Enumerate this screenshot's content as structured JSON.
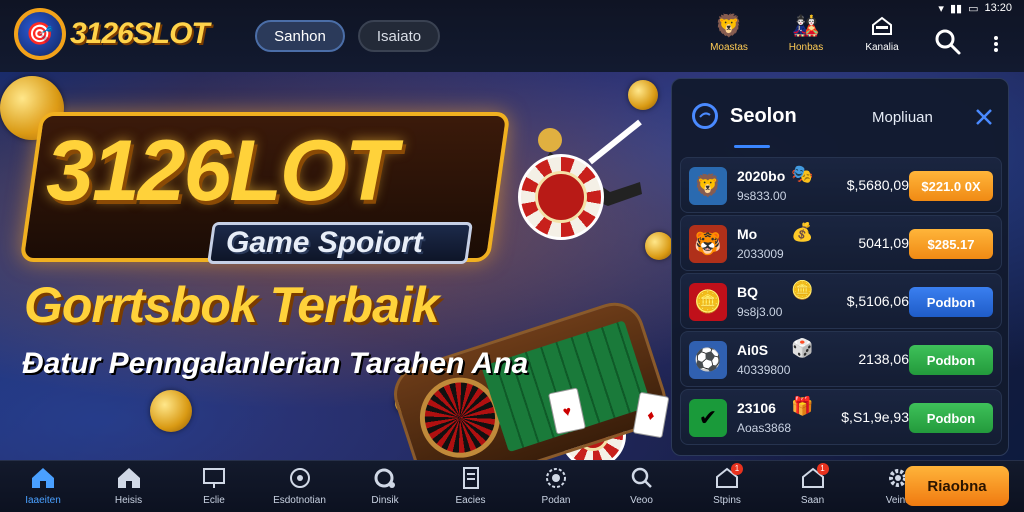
{
  "statusbar": {
    "time": "13:20",
    "icons": [
      "wifi-icon",
      "signal-icon",
      "battery-icon"
    ]
  },
  "header": {
    "logo_text": "3126SLOT",
    "logo_badge": "🎯",
    "pill_primary": "Sanhon",
    "pill_secondary": "Isaiato",
    "icons": [
      {
        "name": "promo-icon",
        "label": "Moastas",
        "glyph": "🦁"
      },
      {
        "name": "rewards-icon",
        "label": "Honbas",
        "glyph": "🎎"
      },
      {
        "name": "house-icon",
        "label": "Kanalia",
        "glyph": "🏠"
      }
    ]
  },
  "banner": {
    "brand": "3126LOT",
    "brand_sub": "Game Spoiort",
    "headline": "Gorrtsbok Terbaik",
    "tagline": "Ɖatur Penngalanlerian Tarahen Ana"
  },
  "panel": {
    "title": "Seolon",
    "tab2": "Mopliuan",
    "rows": [
      {
        "name": "2020bo",
        "sub": "9s833.00",
        "value": "$,5680,09",
        "button": "$221.0 0X",
        "style": "orange",
        "glyph": "🦁",
        "icon_bg": "#2a6ab0",
        "badge": "🎭"
      },
      {
        "name": "Mo",
        "sub": "2033009",
        "value": "5041,09",
        "button": "$285.17",
        "style": "orange",
        "glyph": "🐯",
        "icon_bg": "#b0301a",
        "badge": "💰"
      },
      {
        "name": "BQ",
        "sub": "9s8j3.00",
        "value": "$,5106,06",
        "button": "Podbon",
        "style": "blue",
        "glyph": "🪙",
        "icon_bg": "#c0101a",
        "badge": "🪙"
      },
      {
        "name": "Ai0S",
        "sub": "40339800",
        "value": "2138,06",
        "button": "Podbon",
        "style": "green",
        "glyph": "⚽",
        "icon_bg": "#3060b0",
        "badge": "🎲"
      },
      {
        "name": "23106",
        "sub": "Aoas3868",
        "value": "$,S1,9e,93",
        "button": "Podbon",
        "style": "green",
        "glyph": "✔",
        "icon_bg": "#1a9a3a",
        "badge": "🎁"
      }
    ]
  },
  "bottomnav": {
    "items": [
      {
        "name": "nav-home",
        "icon": "home-icon",
        "label": "Iaaeiten",
        "active": true
      },
      {
        "name": "nav-home-2",
        "icon": "home-icon",
        "label": "Heisis",
        "active": false
      },
      {
        "name": "nav-monitor",
        "icon": "monitor-icon",
        "label": "Eclie",
        "active": false
      },
      {
        "name": "nav-sports",
        "icon": "sports-icon",
        "label": "Esdotnotian",
        "active": false
      },
      {
        "name": "nav-camera",
        "icon": "camera-icon",
        "label": "Dinsik",
        "active": false
      },
      {
        "name": "nav-document",
        "icon": "document-icon",
        "label": "Eacies",
        "active": false
      },
      {
        "name": "nav-casino",
        "icon": "casino-icon",
        "label": "Podan",
        "active": false
      },
      {
        "name": "nav-search",
        "icon": "search-icon",
        "label": "Veoo",
        "active": false
      },
      {
        "name": "nav-notifications",
        "icon": "bell-house-icon",
        "label": "Stpins",
        "active": false,
        "badge": "1"
      },
      {
        "name": "nav-alerts",
        "icon": "bell-house-icon",
        "label": "Saan",
        "active": false,
        "badge": "1"
      },
      {
        "name": "nav-settings",
        "icon": "gear-icon",
        "label": "Veins",
        "active": false
      }
    ],
    "cta": "Riaobna"
  },
  "colors": {
    "accent": "#3a86ff",
    "gold": "#ffd23a",
    "orange": "#f08a14",
    "green": "#239a3c"
  }
}
